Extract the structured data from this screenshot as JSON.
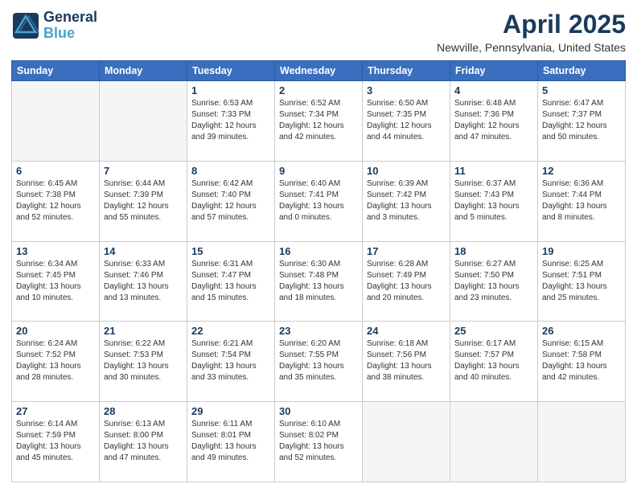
{
  "header": {
    "logo_line1": "General",
    "logo_line2": "Blue",
    "title": "April 2025",
    "subtitle": "Newville, Pennsylvania, United States"
  },
  "weekdays": [
    "Sunday",
    "Monday",
    "Tuesday",
    "Wednesday",
    "Thursday",
    "Friday",
    "Saturday"
  ],
  "weeks": [
    [
      {
        "num": "",
        "info": ""
      },
      {
        "num": "",
        "info": ""
      },
      {
        "num": "1",
        "info": "Sunrise: 6:53 AM\nSunset: 7:33 PM\nDaylight: 12 hours\nand 39 minutes."
      },
      {
        "num": "2",
        "info": "Sunrise: 6:52 AM\nSunset: 7:34 PM\nDaylight: 12 hours\nand 42 minutes."
      },
      {
        "num": "3",
        "info": "Sunrise: 6:50 AM\nSunset: 7:35 PM\nDaylight: 12 hours\nand 44 minutes."
      },
      {
        "num": "4",
        "info": "Sunrise: 6:48 AM\nSunset: 7:36 PM\nDaylight: 12 hours\nand 47 minutes."
      },
      {
        "num": "5",
        "info": "Sunrise: 6:47 AM\nSunset: 7:37 PM\nDaylight: 12 hours\nand 50 minutes."
      }
    ],
    [
      {
        "num": "6",
        "info": "Sunrise: 6:45 AM\nSunset: 7:38 PM\nDaylight: 12 hours\nand 52 minutes."
      },
      {
        "num": "7",
        "info": "Sunrise: 6:44 AM\nSunset: 7:39 PM\nDaylight: 12 hours\nand 55 minutes."
      },
      {
        "num": "8",
        "info": "Sunrise: 6:42 AM\nSunset: 7:40 PM\nDaylight: 12 hours\nand 57 minutes."
      },
      {
        "num": "9",
        "info": "Sunrise: 6:40 AM\nSunset: 7:41 PM\nDaylight: 13 hours\nand 0 minutes."
      },
      {
        "num": "10",
        "info": "Sunrise: 6:39 AM\nSunset: 7:42 PM\nDaylight: 13 hours\nand 3 minutes."
      },
      {
        "num": "11",
        "info": "Sunrise: 6:37 AM\nSunset: 7:43 PM\nDaylight: 13 hours\nand 5 minutes."
      },
      {
        "num": "12",
        "info": "Sunrise: 6:36 AM\nSunset: 7:44 PM\nDaylight: 13 hours\nand 8 minutes."
      }
    ],
    [
      {
        "num": "13",
        "info": "Sunrise: 6:34 AM\nSunset: 7:45 PM\nDaylight: 13 hours\nand 10 minutes."
      },
      {
        "num": "14",
        "info": "Sunrise: 6:33 AM\nSunset: 7:46 PM\nDaylight: 13 hours\nand 13 minutes."
      },
      {
        "num": "15",
        "info": "Sunrise: 6:31 AM\nSunset: 7:47 PM\nDaylight: 13 hours\nand 15 minutes."
      },
      {
        "num": "16",
        "info": "Sunrise: 6:30 AM\nSunset: 7:48 PM\nDaylight: 13 hours\nand 18 minutes."
      },
      {
        "num": "17",
        "info": "Sunrise: 6:28 AM\nSunset: 7:49 PM\nDaylight: 13 hours\nand 20 minutes."
      },
      {
        "num": "18",
        "info": "Sunrise: 6:27 AM\nSunset: 7:50 PM\nDaylight: 13 hours\nand 23 minutes."
      },
      {
        "num": "19",
        "info": "Sunrise: 6:25 AM\nSunset: 7:51 PM\nDaylight: 13 hours\nand 25 minutes."
      }
    ],
    [
      {
        "num": "20",
        "info": "Sunrise: 6:24 AM\nSunset: 7:52 PM\nDaylight: 13 hours\nand 28 minutes."
      },
      {
        "num": "21",
        "info": "Sunrise: 6:22 AM\nSunset: 7:53 PM\nDaylight: 13 hours\nand 30 minutes."
      },
      {
        "num": "22",
        "info": "Sunrise: 6:21 AM\nSunset: 7:54 PM\nDaylight: 13 hours\nand 33 minutes."
      },
      {
        "num": "23",
        "info": "Sunrise: 6:20 AM\nSunset: 7:55 PM\nDaylight: 13 hours\nand 35 minutes."
      },
      {
        "num": "24",
        "info": "Sunrise: 6:18 AM\nSunset: 7:56 PM\nDaylight: 13 hours\nand 38 minutes."
      },
      {
        "num": "25",
        "info": "Sunrise: 6:17 AM\nSunset: 7:57 PM\nDaylight: 13 hours\nand 40 minutes."
      },
      {
        "num": "26",
        "info": "Sunrise: 6:15 AM\nSunset: 7:58 PM\nDaylight: 13 hours\nand 42 minutes."
      }
    ],
    [
      {
        "num": "27",
        "info": "Sunrise: 6:14 AM\nSunset: 7:59 PM\nDaylight: 13 hours\nand 45 minutes."
      },
      {
        "num": "28",
        "info": "Sunrise: 6:13 AM\nSunset: 8:00 PM\nDaylight: 13 hours\nand 47 minutes."
      },
      {
        "num": "29",
        "info": "Sunrise: 6:11 AM\nSunset: 8:01 PM\nDaylight: 13 hours\nand 49 minutes."
      },
      {
        "num": "30",
        "info": "Sunrise: 6:10 AM\nSunset: 8:02 PM\nDaylight: 13 hours\nand 52 minutes."
      },
      {
        "num": "",
        "info": ""
      },
      {
        "num": "",
        "info": ""
      },
      {
        "num": "",
        "info": ""
      }
    ]
  ]
}
